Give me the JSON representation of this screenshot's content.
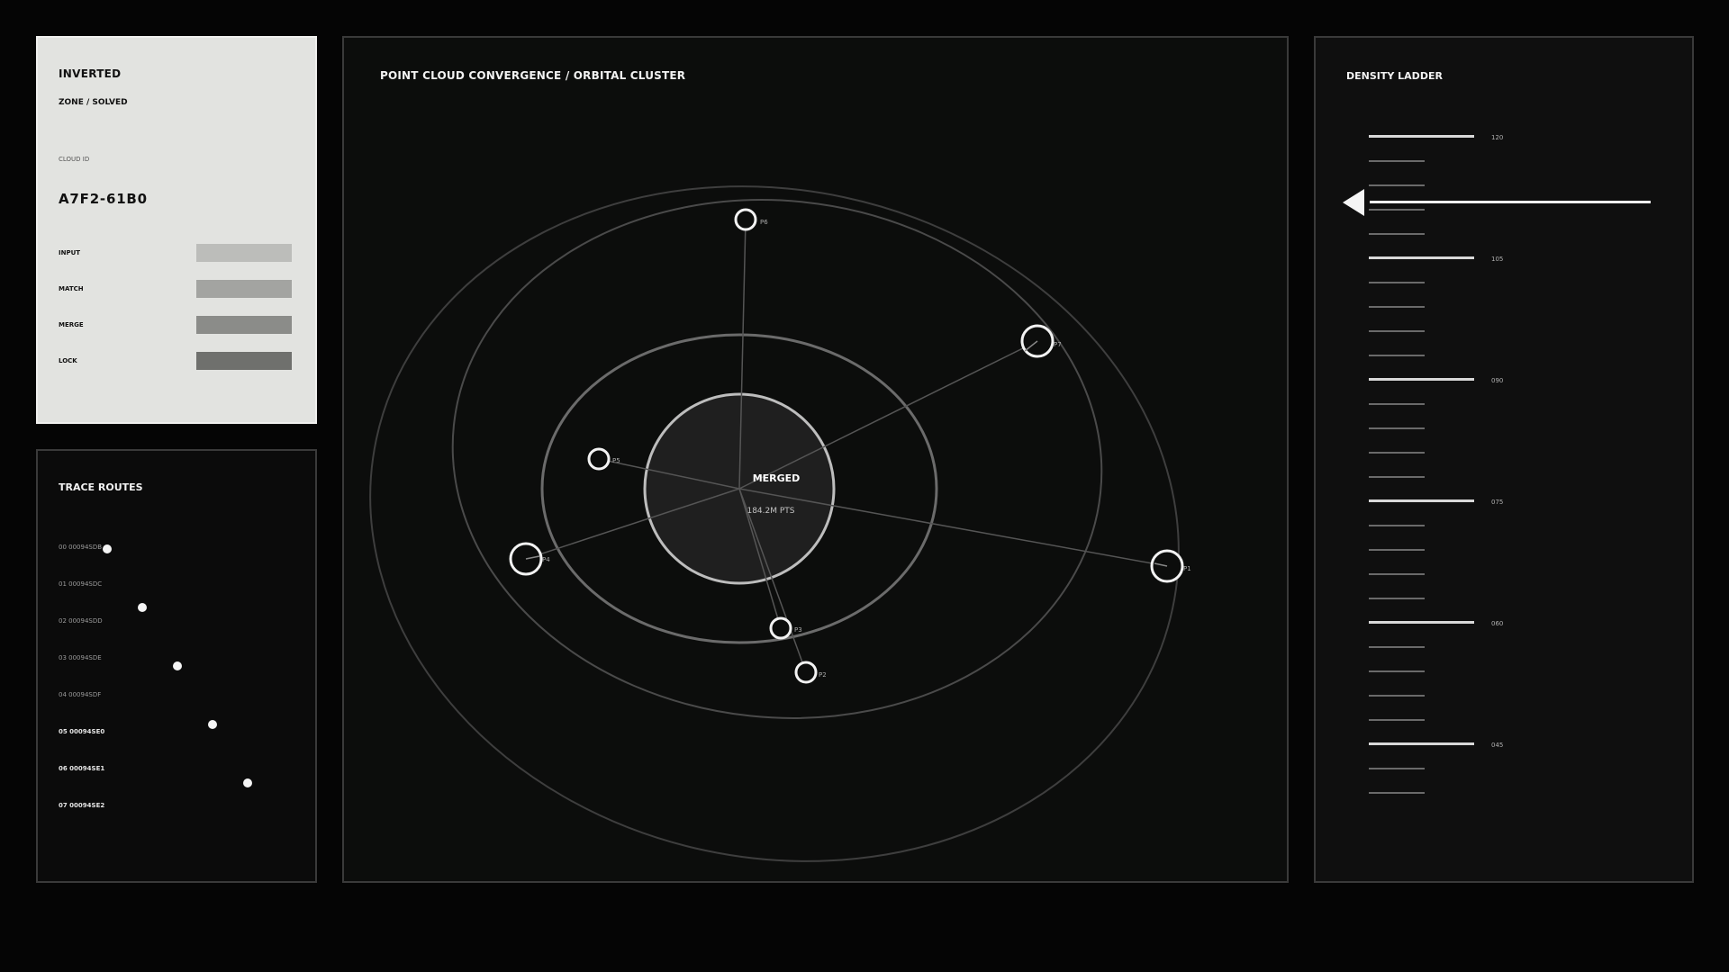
{
  "inverted_card": {
    "title": "INVERTED",
    "subtitle": "ZONE / SOLVED",
    "cloud_id_label": "CLOUD ID",
    "cloud_id": "A7F2-61B0",
    "stages": [
      {
        "label": "INPUT",
        "color": "#bcbdba"
      },
      {
        "label": "MATCH",
        "color": "#a3a4a1"
      },
      {
        "label": "MERGE",
        "color": "#8b8c89"
      },
      {
        "label": "LOCK",
        "color": "#6f706d"
      }
    ]
  },
  "trace_routes": {
    "title": "TRACE ROUTES",
    "routes": [
      "00 00094SDB",
      "01 00094SDC",
      "02 00094SDD",
      "03 00094SDE",
      "04 00094SDF",
      "05 00094SE0",
      "06 00094SE1",
      "07 00094SE2"
    ]
  },
  "orbital": {
    "title": "POINT CLOUD CONVERGENCE / ORBITAL CLUSTER",
    "center_label": "MERGED",
    "center_value": "184.2M PTS",
    "nodes": [
      "P1",
      "P2",
      "P3",
      "P4",
      "P5",
      "P6",
      "P7"
    ]
  },
  "density_ladder": {
    "title": "DENSITY LADDER",
    "labels": [
      "120",
      "105",
      "090",
      "075",
      "060",
      "045"
    ],
    "pointer_value": 111
  }
}
